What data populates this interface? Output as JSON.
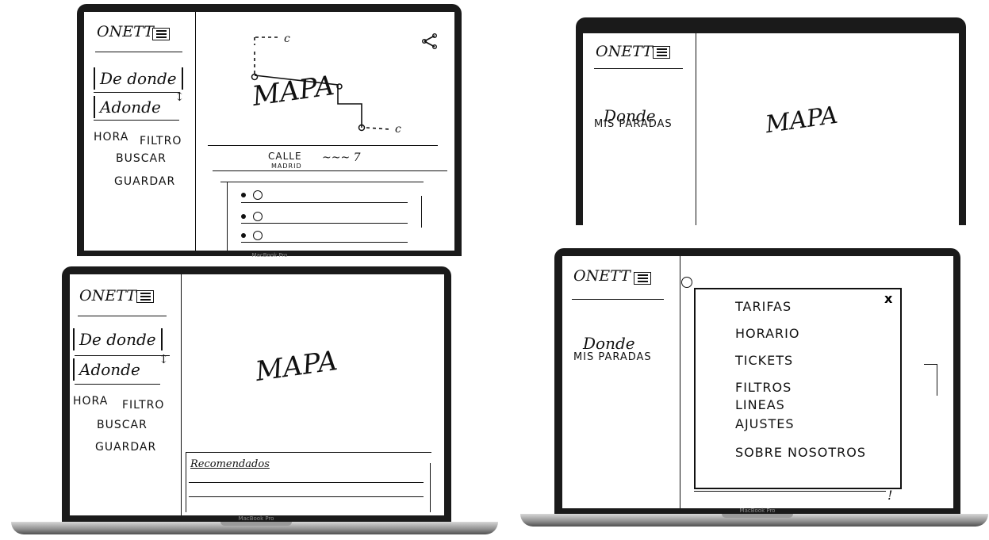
{
  "brand": {
    "logo": "ONETT",
    "device": "MacBook Pro"
  },
  "screen1": {
    "from_field": "De donde",
    "to_field": "Adonde",
    "swap_icon": "swap-arrows-icon",
    "time_option": "HORA",
    "filter_option": "FILTRO",
    "search_button": "BUSCAR",
    "save_button": "GUARDAR",
    "map_label": "MAPA",
    "route_label": "CALLE",
    "route_sub": "MADRID",
    "route_note": "~~~ 7",
    "route_end_a": "c",
    "route_end_b": "c",
    "share_icon": "share-icon"
  },
  "screen2": {
    "where_label": "Donde",
    "my_stops": "MIS PARADAS",
    "map_label": "MAPA"
  },
  "screen3": {
    "from_field": "De donde",
    "to_field": "Adonde",
    "time_option": "HORA",
    "filter_option": "FILTRO",
    "search_button": "BUSCAR",
    "save_button": "GUARDAR",
    "map_label": "MAPA",
    "recommended_label": "Recomendados"
  },
  "screen4": {
    "where_label": "Donde",
    "my_stops": "MIS PARADAS",
    "close_label": "x",
    "menu_items": [
      "TARIFAS",
      "HORARIO",
      "TICKETS",
      "FILTROS",
      "LINEAS",
      "AJUSTES",
      "SOBRE NOSOTROS"
    ],
    "bottom_mark": "!"
  }
}
